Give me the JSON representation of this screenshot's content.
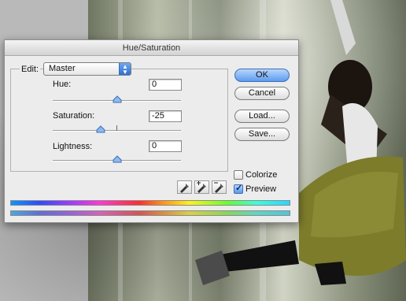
{
  "dialog": {
    "title": "Hue/Saturation",
    "edit_label": "Edit:",
    "edit_value": "Master",
    "hue": {
      "label": "Hue:",
      "value": "0",
      "level": 0.5
    },
    "saturation": {
      "label": "Saturation:",
      "value": "-25",
      "level": 0.375
    },
    "lightness": {
      "label": "Lightness:",
      "value": "0",
      "level": 0.5
    },
    "buttons": {
      "ok": "OK",
      "cancel": "Cancel",
      "load": "Load...",
      "save": "Save..."
    },
    "colorize": {
      "label": "Colorize",
      "checked": false
    },
    "preview": {
      "label": "Preview",
      "checked": true
    },
    "eyedroppers": [
      "eyedropper-icon",
      "eyedropper-plus-icon",
      "eyedropper-minus-icon"
    ],
    "colors": {
      "ok_button": "#5d9cf0",
      "checkbox_checked": "#5a99ee"
    }
  }
}
